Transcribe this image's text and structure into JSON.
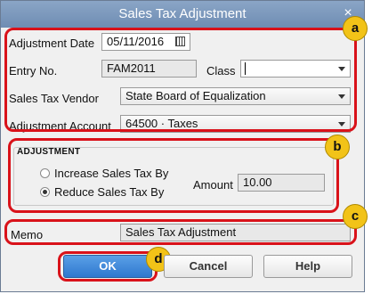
{
  "window": {
    "title": "Sales Tax Adjustment",
    "close_glyph": "×"
  },
  "form": {
    "adjustment_date_label": "Adjustment Date",
    "adjustment_date_value": "05/11/2016",
    "entry_no_label": "Entry No.",
    "entry_no_value": "FAM2011",
    "class_label": "Class",
    "class_value": "",
    "vendor_label": "Sales Tax Vendor",
    "vendor_value": "State Board of Equalization",
    "account_label": "Adjustment Account",
    "account_value": "64500 · Taxes"
  },
  "adjustment": {
    "group_title": "ADJUSTMENT",
    "option_increase": "Increase Sales Tax By",
    "option_reduce": "Reduce Sales Tax By",
    "selected": "reduce",
    "amount_label": "Amount",
    "amount_value": "10.00"
  },
  "memo": {
    "label": "Memo",
    "value": "Sales Tax Adjustment"
  },
  "buttons": {
    "ok": "OK",
    "cancel": "Cancel",
    "help": "Help"
  },
  "callouts": {
    "a": "a",
    "b": "b",
    "c": "c",
    "d": "d"
  },
  "colors": {
    "highlight": "#d9121a",
    "badge": "#f2c318",
    "titlebar": "#7b97bc",
    "ok_button": "#3b84d8"
  }
}
